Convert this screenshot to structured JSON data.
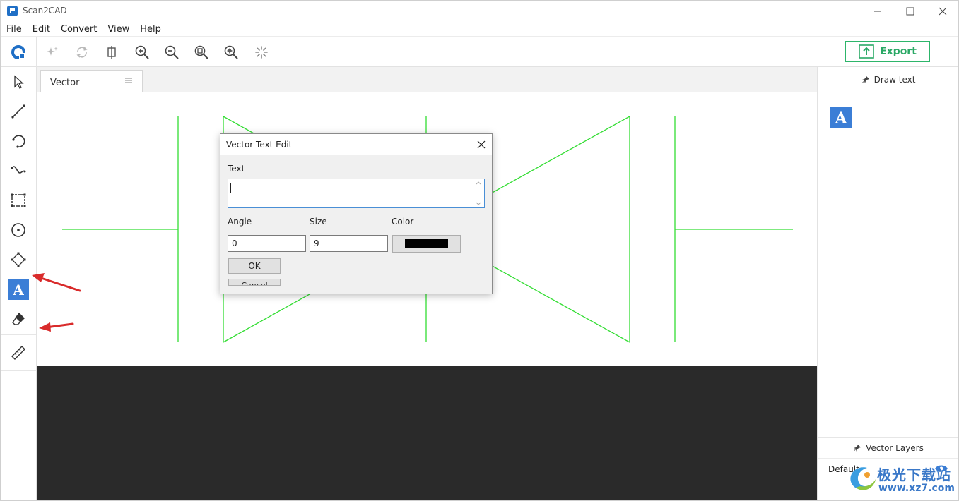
{
  "window": {
    "title": "Scan2CAD"
  },
  "menu": {
    "items": [
      "File",
      "Edit",
      "Convert",
      "View",
      "Help"
    ]
  },
  "toolbar": {
    "buttons": [
      "app-logo-icon",
      "sparkle-icon",
      "refresh-icon",
      "crop-icon",
      "zoom-in-icon",
      "zoom-out-icon",
      "zoom-fit-icon",
      "zoom-extent-icon",
      "loading-icon"
    ],
    "export_label": "Export"
  },
  "left_tools": [
    "select-arrow-icon",
    "line-icon",
    "arc-icon",
    "curve-icon",
    "rectangle-icon",
    "circle-icon",
    "node-edit-icon",
    "text-tool-icon",
    "eraser-icon",
    "ruler-icon"
  ],
  "active_tool": "text-tool-icon",
  "tab": {
    "label": "Vector"
  },
  "right_panel": {
    "draw_text_header": "Draw text",
    "text_icon_letter": "A",
    "layers_header": "Vector Layers",
    "layer_name": "Default"
  },
  "dialog": {
    "title": "Vector Text Edit",
    "text_label": "Text",
    "text_value": "",
    "angle_label": "Angle",
    "angle_value": "0",
    "size_label": "Size",
    "size_value": "9",
    "color_label": "Color",
    "color_value": "#000000",
    "ok_label": "OK",
    "cancel_label": "Cancel"
  },
  "colors": {
    "accent_blue": "#3b7ed6",
    "export_green": "#2aa865",
    "drawing_green": "#33dd33",
    "annotation_red": "#d92b2b",
    "dark_area": "#2a2a2a"
  },
  "watermark": {
    "text_cn": "极光下载站",
    "url": "www.xz7.com"
  }
}
